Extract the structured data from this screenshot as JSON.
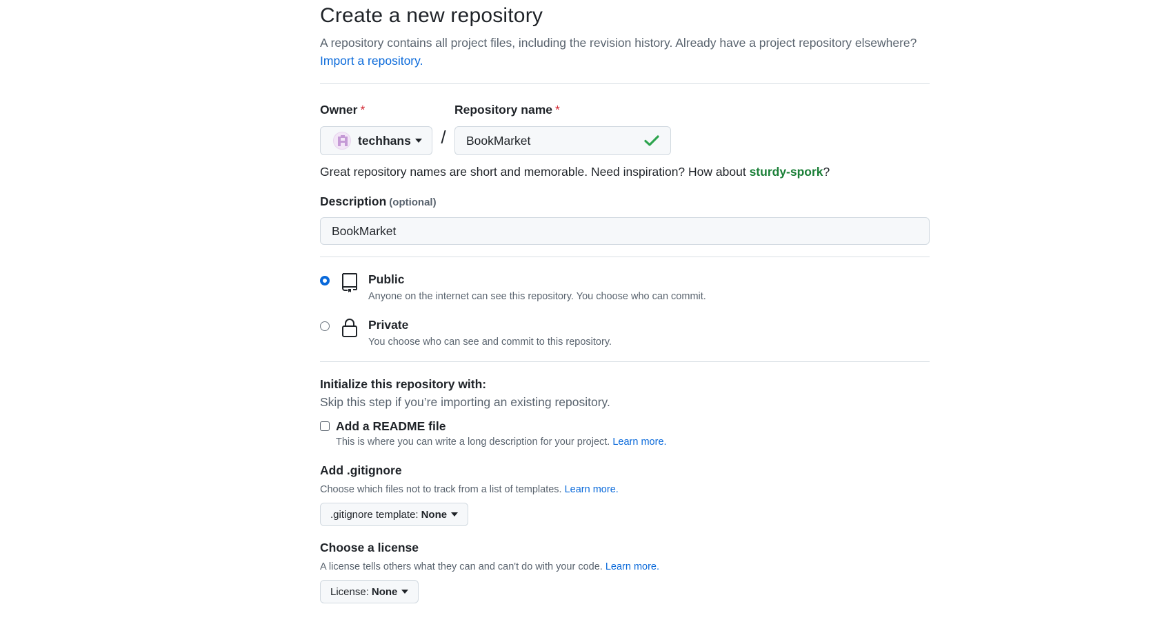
{
  "header": {
    "title": "Create a new repository",
    "subtitle": "A repository contains all project files, including the revision history. Already have a project repository elsewhere?",
    "import_link": "Import a repository."
  },
  "owner": {
    "label": "Owner",
    "required_mark": "*",
    "value": "techhans"
  },
  "slash": "/",
  "repo_name": {
    "label": "Repository name",
    "required_mark": "*",
    "value": "BookMarket"
  },
  "name_hint": {
    "text": "Great repository names are short and memorable. Need inspiration? How about",
    "suggestion": "sturdy-spork",
    "end": "?"
  },
  "description": {
    "label": "Description",
    "optional": "(optional)",
    "value": "BookMarket"
  },
  "visibility": {
    "public_title": "Public",
    "public_desc": "Anyone on the internet can see this repository. You choose who can commit.",
    "private_title": "Private",
    "private_desc": "You choose who can see and commit to this repository.",
    "selected": "Public"
  },
  "init": {
    "title": "Initialize this repository with:",
    "subtitle": "Skip this step if you’re importing an existing repository.",
    "readme_label": "Add a README file",
    "readme_desc": "This is where you can write a long description for your project.",
    "readme_checked": false,
    "learn_more": "Learn more."
  },
  "gitignore": {
    "title": "Add .gitignore",
    "desc": "Choose which files not to track from a list of templates.",
    "learn_more": "Learn more.",
    "select_label": ".gitignore template:",
    "select_value": "None"
  },
  "license": {
    "title": "Choose a license",
    "desc": "A license tells others what they can and can't do with your code.",
    "learn_more": "Learn more.",
    "select_label": "License:",
    "select_value": "None"
  },
  "colors": {
    "link": "#0969da",
    "suggestion": "#1a7f37",
    "required": "#d1242f",
    "check": "#1a7f37"
  }
}
